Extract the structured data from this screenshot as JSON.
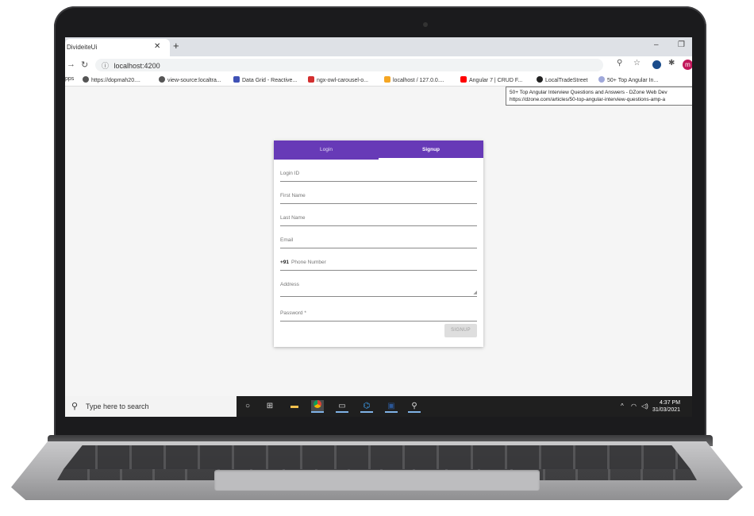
{
  "browser": {
    "tab_title": "DivideiteUi",
    "tab_close": "✕",
    "new_tab": "+",
    "minimize": "–",
    "restore": "❐",
    "url": "localhost:4200",
    "bookmarks": [
      {
        "label": "pps",
        "color": ""
      },
      {
        "label": "https://dopmah20....",
        "color": "#555555"
      },
      {
        "label": "view-source:localtra...",
        "color": "#555555"
      },
      {
        "label": "Data Grid - Reactive...",
        "color": "#3f51b5"
      },
      {
        "label": "ngx-owl-carousel-o...",
        "color": "#d32f2f"
      },
      {
        "label": "localhost / 127.0.0....",
        "color": "#f5a623"
      },
      {
        "label": "Angular 7 | CRUD F...",
        "color": "#ff0000"
      },
      {
        "label": "LocalTradeStreet",
        "color": "#222222"
      },
      {
        "label": "50+ Top Angular In...",
        "color": "#9fa8da"
      }
    ],
    "tooltip_line1": "50+ Top Angular Interview Questions and Answers - DZone Web Dev",
    "tooltip_line2": "https://dzone.com/articles/50-top-angular-interview-questions-amp-a",
    "profile_initial": "m"
  },
  "form": {
    "tabs": {
      "login": "Login",
      "signup": "Signup"
    },
    "fields": {
      "login_id": "Login ID",
      "first_name": "First Name",
      "last_name": "Last Name",
      "email": "Email",
      "phone_prefix": "+91",
      "phone": "Phone Number",
      "address": "Address",
      "password": "Password *"
    },
    "signup_button": "SIGNUP"
  },
  "taskbar": {
    "search_placeholder": "Type here to search",
    "time": "4:37 PM",
    "date": "31/03/2021"
  },
  "colors": {
    "tab_header": "#673ab7",
    "taskbar": "#1f1f1f"
  }
}
